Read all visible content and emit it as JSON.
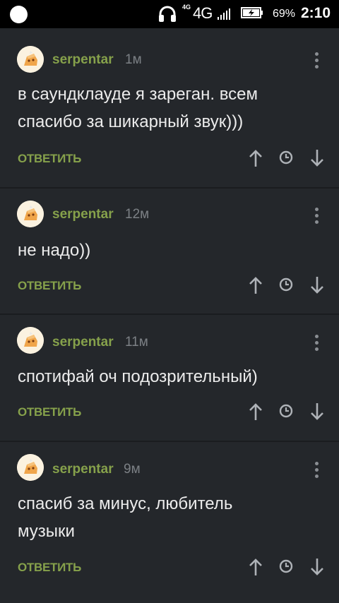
{
  "status": {
    "network_small": "4G",
    "network": "4G",
    "battery": "69%",
    "time": "2:10"
  },
  "colors": {
    "accent": "#86a14b",
    "background": "#24272b",
    "meta": "#7c8085"
  },
  "comments": [
    {
      "username": "serpentar",
      "time": "1м",
      "text": "в саундклауде я зареган. всем спасибо за шикарный звук)))",
      "reply": "ОТВЕТИТЬ"
    },
    {
      "username": "serpentar",
      "time": "12м",
      "text": "не надо))",
      "reply": "ОТВЕТИТЬ"
    },
    {
      "username": "serpentar",
      "time": "11м",
      "text": "спотифай оч подозрительный)",
      "reply": "ОТВЕТИТЬ"
    },
    {
      "username": "serpentar",
      "time": "9м",
      "text": "спасиб за минус, любитель музыки",
      "reply": "ОТВЕТИТЬ"
    }
  ],
  "icons": [
    "headphones-icon",
    "signal-icon",
    "battery-charging-icon",
    "more-vert-icon",
    "arrow-up-icon",
    "clock-icon",
    "arrow-down-icon"
  ]
}
